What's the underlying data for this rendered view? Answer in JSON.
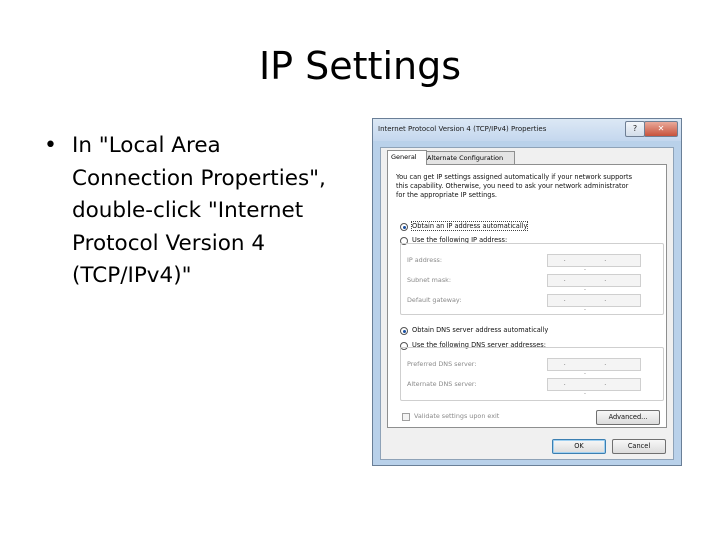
{
  "slide": {
    "title": "IP Settings",
    "bullet_symbol": "•",
    "bullet_lines": [
      "In \"Local Area",
      "Connection Properties\",",
      "double-click \"Internet",
      "Protocol Version 4",
      "(TCP/IPv4)\""
    ]
  },
  "dialog": {
    "title": "Internet Protocol Version 4 (TCP/IPv4) Properties",
    "help_label": "?",
    "close_label": "✕",
    "tabs": [
      {
        "label": "General",
        "selected": true
      },
      {
        "label": "Alternate Configuration",
        "selected": false
      }
    ],
    "description_lines": [
      "You can get IP settings assigned automatically if your network supports",
      "this capability. Otherwise, you need to ask your network administrator",
      "for the appropriate IP settings."
    ],
    "ip_auto_label": "Obtain an IP address automatically",
    "ip_manual_label": "Use the following IP address:",
    "ip_fields": {
      "ip_address": {
        "label": "IP address:",
        "value": ".   .   ."
      },
      "subnet_mask": {
        "label": "Subnet mask:",
        "value": ".   .   ."
      },
      "default_gateway": {
        "label": "Default gateway:",
        "value": ".   .   ."
      }
    },
    "dns_auto_label": "Obtain DNS server address automatically",
    "dns_manual_label": "Use the following DNS server addresses:",
    "dns_fields": {
      "preferred": {
        "label": "Preferred DNS server:",
        "value": ".   .   ."
      },
      "alternate": {
        "label": "Alternate DNS server:",
        "value": ".   .   ."
      }
    },
    "validate_label": "Validate settings upon exit",
    "advanced_label": "Advanced...",
    "ok_label": "OK",
    "cancel_label": "Cancel"
  }
}
